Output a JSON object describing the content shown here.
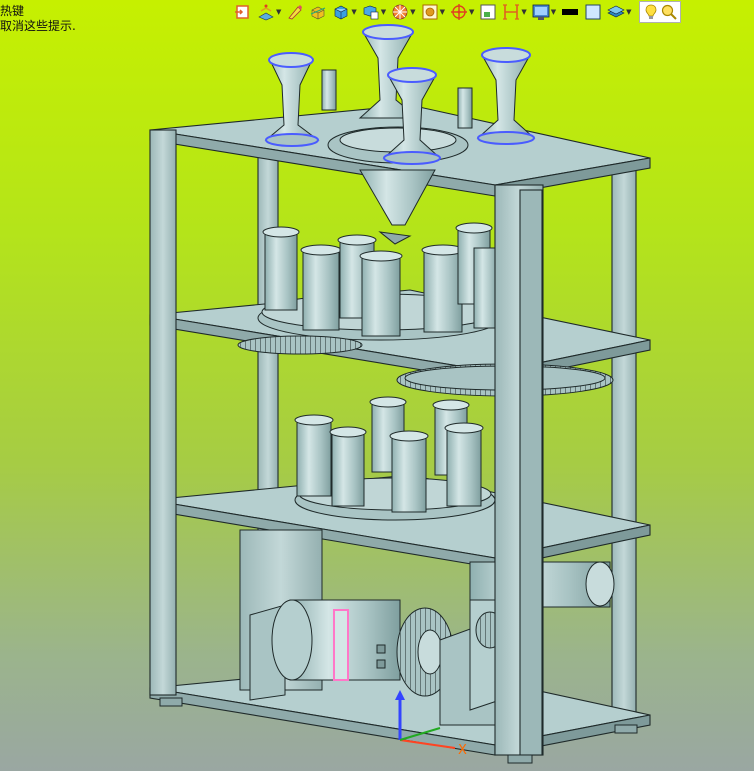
{
  "hint": {
    "line1": "热键",
    "line2": "取消这些提示."
  },
  "toolbar": {
    "buttons": [
      {
        "icon": "view-orient-icon"
      },
      {
        "icon": "display-style-icon"
      },
      {
        "icon": "edit-appearance-icon"
      },
      {
        "icon": "section-view-icon"
      },
      {
        "icon": "shaded-cube-icon"
      },
      {
        "icon": "hide-show-icon"
      },
      {
        "icon": "view-setting-icon"
      },
      {
        "icon": "coordinate-icon"
      },
      {
        "icon": "scene-icon"
      },
      {
        "icon": "zoom-fit-icon"
      },
      {
        "icon": "standard-views-icon"
      },
      {
        "icon": "display-pane-icon"
      },
      {
        "icon": "line-color-icon"
      },
      {
        "icon": "background-color-icon"
      },
      {
        "icon": "layer-icon"
      },
      {
        "icon": "lightbulb-icon"
      },
      {
        "icon": "search-icon"
      }
    ]
  },
  "model": {
    "colors": {
      "body": "#a9c4c4",
      "edge": "#1f2a2a",
      "highlight_blue": "#4a5cff",
      "highlight_pink": "#ff77c8"
    }
  },
  "triad": {
    "x_label": "X"
  }
}
